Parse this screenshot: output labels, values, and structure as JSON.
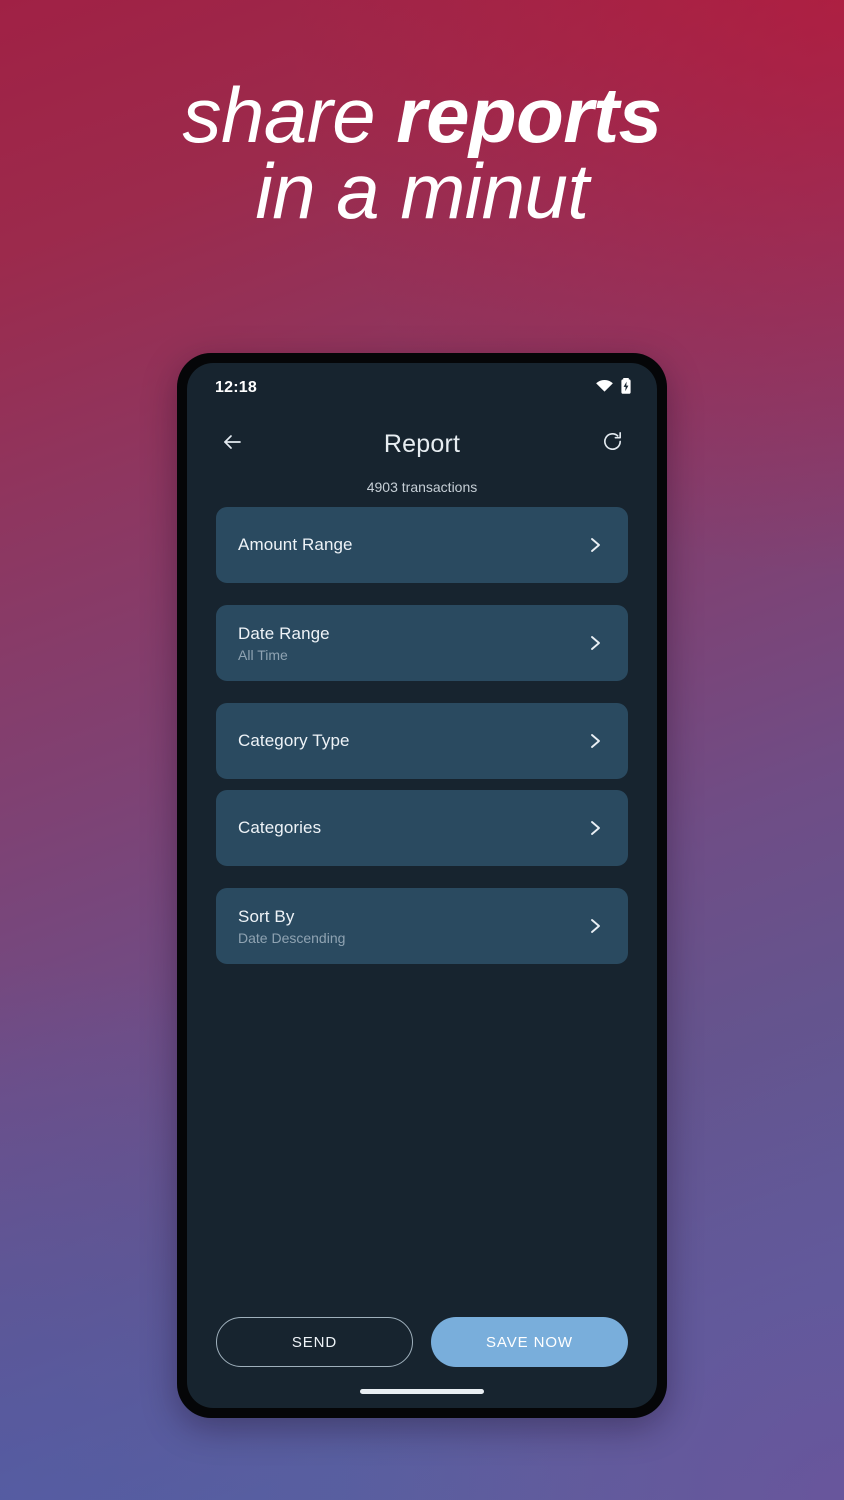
{
  "promo": {
    "headline_line1_thin": "share ",
    "headline_line1_bold": "reports",
    "headline_line2": "in a minut",
    "background_top_color": "#a02145",
    "background_bottom_color": "#5d61a0"
  },
  "statusbar": {
    "time": "12:18",
    "wifi_icon": "wifi-icon",
    "battery_icon": "battery-charging-icon"
  },
  "appbar": {
    "back_icon": "arrow-left-icon",
    "title": "Report",
    "refresh_icon": "refresh-icon"
  },
  "main": {
    "transaction_count_label": "4903 transactions",
    "cards": [
      {
        "title": "Amount Range",
        "subtitle": "",
        "chevron": "chevron-right-icon"
      },
      {
        "title": "Date Range",
        "subtitle": "All Time",
        "chevron": "chevron-right-icon"
      },
      {
        "title": "Category Type",
        "subtitle": "",
        "chevron": "chevron-right-icon"
      },
      {
        "title": "Categories",
        "subtitle": "",
        "chevron": "chevron-right-icon"
      },
      {
        "title": "Sort By",
        "subtitle": "Date Descending",
        "chevron": "chevron-right-icon"
      }
    ],
    "card_background_color": "#2a4a60",
    "screen_background_color": "#17242f"
  },
  "actions": {
    "send_label": "SEND",
    "save_label": "SAVE NOW",
    "save_button_color": "#79aedb"
  }
}
